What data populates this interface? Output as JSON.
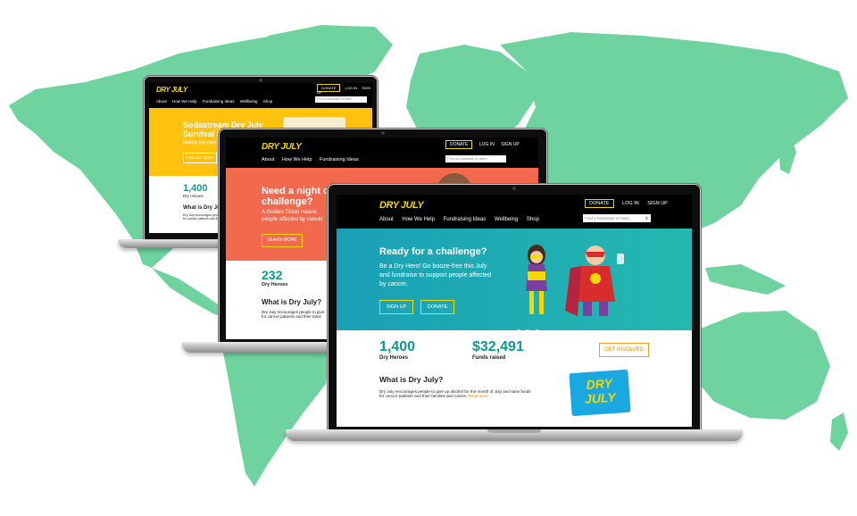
{
  "colors": {
    "map": "#6fd3a0",
    "accent": "#f5d800",
    "teal": "#0a9a92",
    "hero1": "#ffc20e",
    "hero2": "#f2694e",
    "hero3": "#1aa0b6"
  },
  "laptop1": {
    "logo": "DRY JULY",
    "top": [
      "DONATE",
      "LOG IN",
      "SIGN UP"
    ],
    "nav": [
      "About",
      "How We Help",
      "Fundraising Ideas",
      "Wellbeing",
      "Shop"
    ],
    "search_placeholder": "Find a fundraiser or team",
    "hero_title_1": "Sodastream Dry July",
    "hero_title_2": "Survival Kit",
    "hero_text": "Making Dry easy this",
    "button": "FIND OUT MORE",
    "stat_num": "1,400",
    "stat_label": "Dry Heroes",
    "what_title": "What is Dry July?",
    "what_text_1": "Dry July encourages people to give",
    "what_text_2": "for cancer patients and their families"
  },
  "laptop2": {
    "logo": "DRY JULY",
    "top": [
      "DONATE",
      "LOG IN",
      "SIGN UP"
    ],
    "nav": [
      "About",
      "How We Help",
      "Fundraising Ideas"
    ],
    "search_placeholder": "Find a fundraiser or team",
    "hero_title_1": "Need a night off f",
    "hero_title_2": "challenge?",
    "hero_text_1": "A Golden Ticket means",
    "hero_text_2": "people affected by cancer",
    "button": "LEARN MORE",
    "stat_num": "232",
    "stat_label": "Dry Heroes",
    "what_title": "What is Dry July?",
    "what_text_1": "Dry July encourages people to give",
    "what_text_2": "for cancer patients and their famil"
  },
  "laptop3": {
    "logo": "DRY JULY",
    "top": [
      "DONATE",
      "LOG IN",
      "SIGN UP"
    ],
    "nav": [
      "About",
      "How We Help",
      "Fundraising Ideas",
      "Wellbeing",
      "Shop"
    ],
    "search_placeholder": "Find a fundraiser or team",
    "hero_title": "Ready for a challenge?",
    "hero_text_1": "Be a Dry Hero! Go booze-free this July",
    "hero_text_2": "and fundraise to support people affected",
    "hero_text_3": "by cancer.",
    "btn_signup": "SIGN UP",
    "btn_donate": "DONATE",
    "stat1_num": "1,400",
    "stat1_label": "Dry Heroes",
    "stat2_num": "$32,491",
    "stat2_label": "Funds raised",
    "get_involved": "GET INVOLVED",
    "what_title": "What is Dry July?",
    "what_text_1": "Dry July encourages people to give up alcohol for the month of July and raise funds",
    "what_text_2": "for cancer patients and their families and carers.",
    "read_more": "Read more...",
    "badge_1": "DRY",
    "badge_2": "JULY"
  }
}
